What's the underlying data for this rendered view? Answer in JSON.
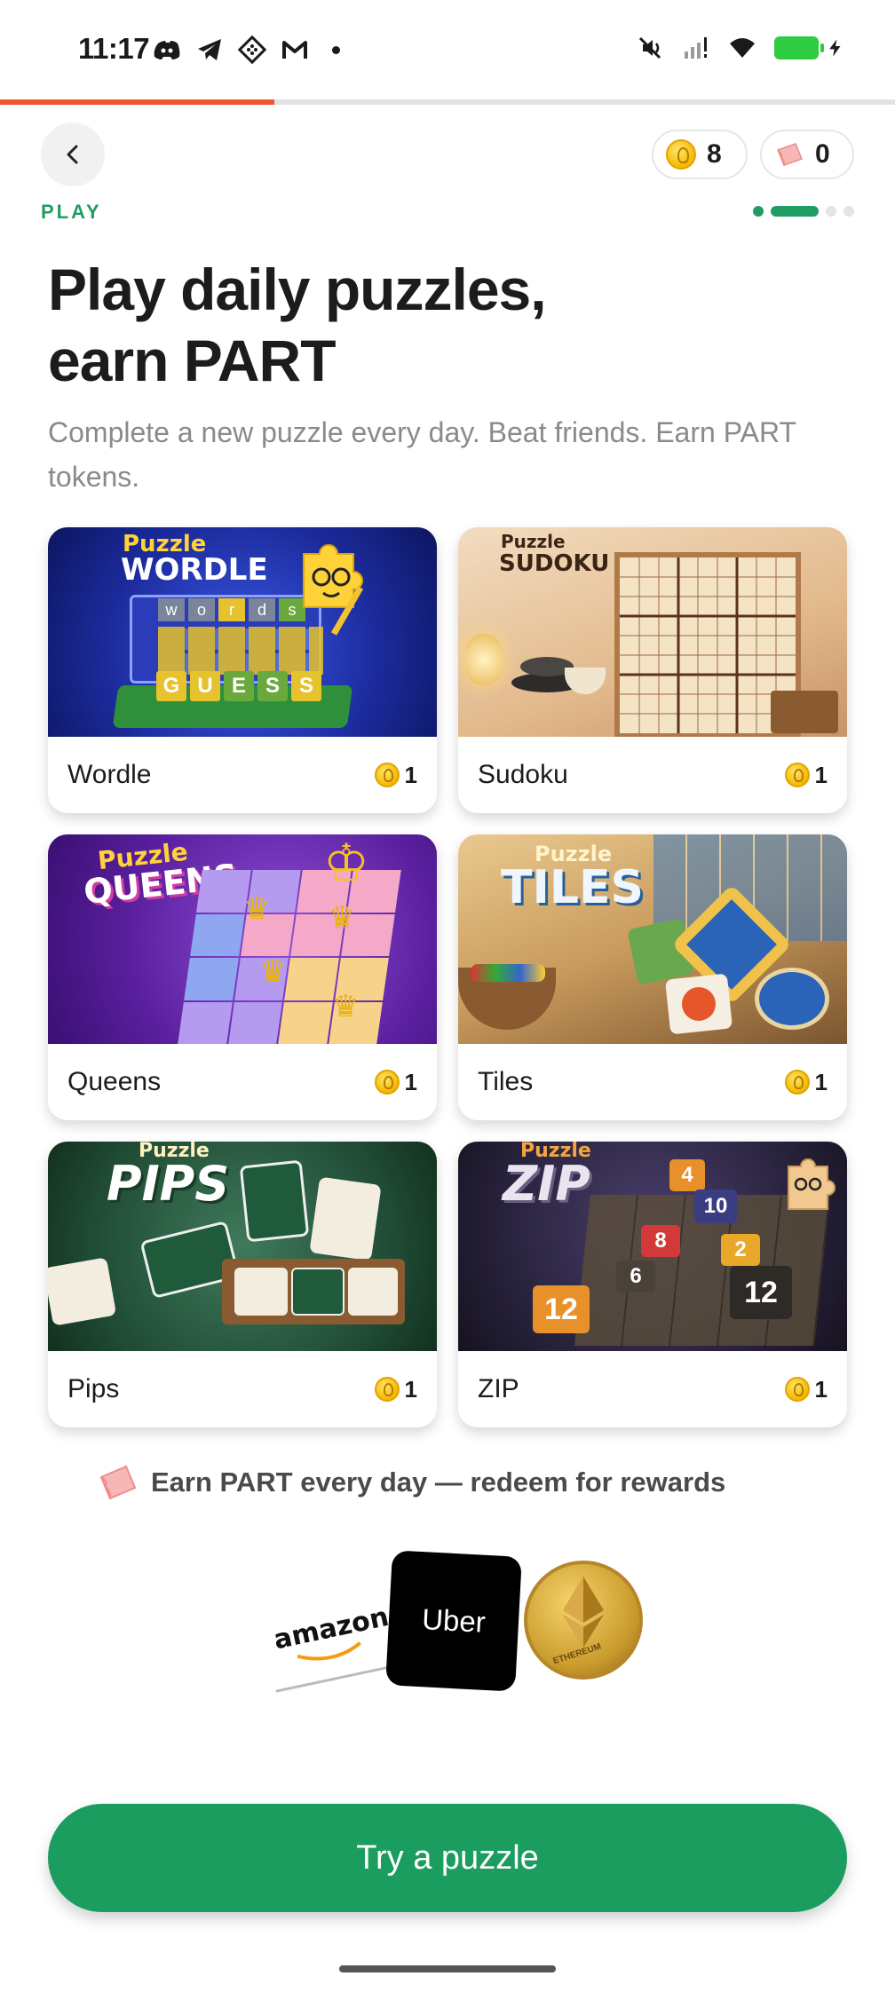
{
  "status_bar": {
    "time": "11:17",
    "left_icons": [
      "discord-icon",
      "telegram-icon",
      "grid-app-icon",
      "gmail-icon",
      "notification-dot"
    ],
    "right_icons": [
      "mute-icon",
      "signal-icon",
      "wifi-icon",
      "battery-charging-icon"
    ]
  },
  "progress": {
    "fraction": 0.307
  },
  "header": {
    "coins": "8",
    "part_tokens": "0",
    "section_label": "PLAY",
    "step_count": 4,
    "current_step": 2
  },
  "hero": {
    "title_line1": "Play daily puzzles,",
    "title_line2": "earn PART",
    "subtitle": "Complete a new puzzle every day. Beat friends. Earn PART tokens."
  },
  "games": [
    {
      "name": "Wordle",
      "cost": "1",
      "art_word": "WORDLE",
      "art_prefix": "Puzzle",
      "art_tiles": [
        "w",
        "o",
        "r",
        "d",
        "s"
      ],
      "art_guess": [
        "G",
        "U",
        "E",
        "S",
        "S"
      ]
    },
    {
      "name": "Sudoku",
      "cost": "1",
      "art_word": "SUDOKU",
      "art_prefix": "Puzzle"
    },
    {
      "name": "Queens",
      "cost": "1",
      "art_word": "QUEENS",
      "art_prefix": "Puzzle"
    },
    {
      "name": "Tiles",
      "cost": "1",
      "art_word": "TILES",
      "art_prefix": "Puzzle"
    },
    {
      "name": "Pips",
      "cost": "1",
      "art_word": "PIPS",
      "art_prefix": "Puzzle"
    },
    {
      "name": "ZIP",
      "cost": "1",
      "art_word": "ZIP",
      "art_prefix": "Puzzle",
      "art_numbers": [
        "4",
        "10",
        "8",
        "2",
        "6",
        "12",
        "12"
      ]
    }
  ],
  "earn": {
    "text": "Earn PART every day — redeem for rewards"
  },
  "rewards": {
    "amazon": "amazon",
    "uber": "Uber",
    "eth": "ETHEREUM"
  },
  "cta": {
    "label": "Try a puzzle"
  },
  "colors": {
    "accent": "#1b9d5f",
    "progress": "#f1562f",
    "coin": "#f5b800"
  }
}
